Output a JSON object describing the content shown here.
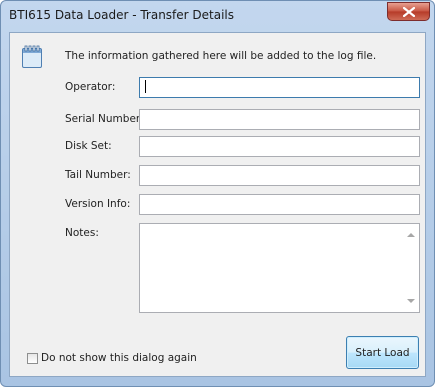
{
  "window": {
    "title": "BTI615 Data Loader - Transfer Details"
  },
  "info": {
    "text": "The information gathered here will be added to the log file."
  },
  "fields": [
    {
      "label": "Operator:",
      "value": ""
    },
    {
      "label": "Serial Number:",
      "value": ""
    },
    {
      "label": "Disk Set:",
      "value": ""
    },
    {
      "label": "Tail Number:",
      "value": ""
    },
    {
      "label": "Version Info:",
      "value": ""
    }
  ],
  "notes": {
    "label": "Notes:",
    "value": ""
  },
  "options": {
    "dont_show_label": "Do not show this dialog again",
    "dont_show_checked": false
  },
  "buttons": {
    "start_load": "Start Load"
  },
  "icons": {
    "close": "close-icon",
    "info": "notepad-icon",
    "scroll_up": "scroll-up-arrow-icon",
    "scroll_down": "scroll-down-arrow-icon"
  }
}
